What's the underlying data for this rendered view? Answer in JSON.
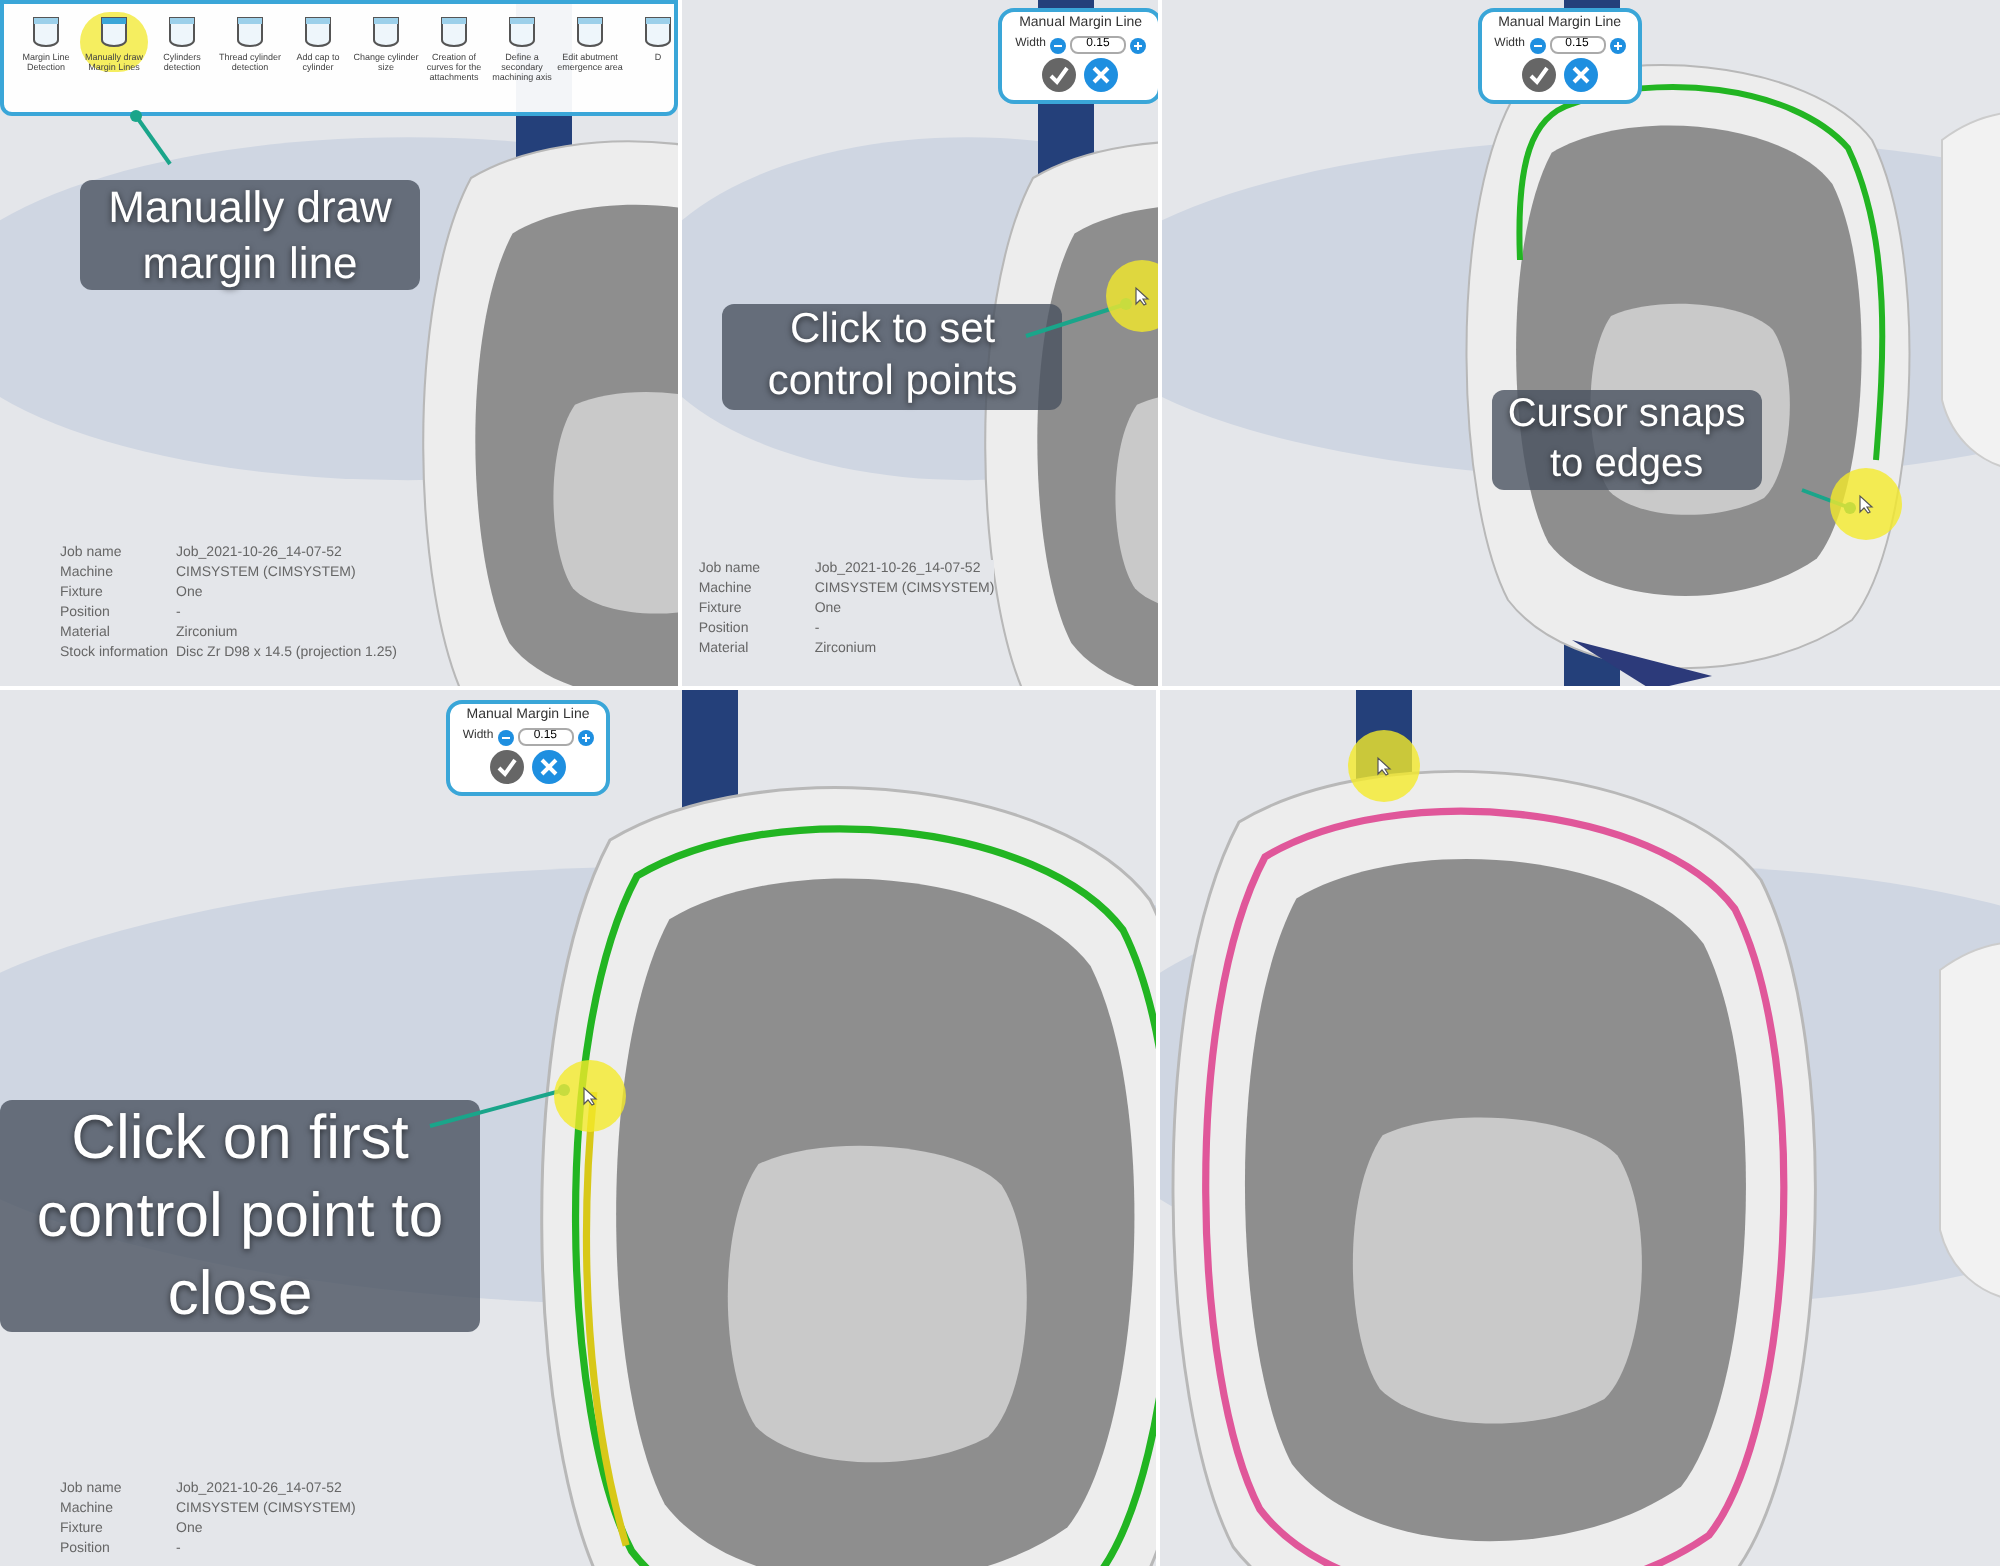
{
  "panels": [
    {
      "toolbar": [
        {
          "label": "Margin Line Detection",
          "selected": false
        },
        {
          "label": "Manually draw Margin Lines",
          "selected": true
        },
        {
          "label": "Cylinders detection",
          "selected": false
        },
        {
          "label": "Thread cylinder detection",
          "selected": false
        },
        {
          "label": "Add cap to cylinder",
          "selected": false
        },
        {
          "label": "Change cylinder size",
          "selected": false
        },
        {
          "label": "Creation of curves for the attachments",
          "selected": false
        },
        {
          "label": "Define a secondary machining axis",
          "selected": false
        },
        {
          "label": "Edit abutment emergence area",
          "selected": false
        },
        {
          "label": "D",
          "selected": false
        }
      ],
      "caption": "Manually draw margin line",
      "info": [
        {
          "label": "Job name",
          "value": "Job_2021-10-26_14-07-52"
        },
        {
          "label": "Machine",
          "value": "CIMSYSTEM (CIMSYSTEM)"
        },
        {
          "label": "Fixture",
          "value": "One"
        },
        {
          "label": "Position",
          "value": "-"
        },
        {
          "label": "Material",
          "value": "Zirconium"
        },
        {
          "label": "Stock information",
          "value": "Disc Zr D98 x 14.5 (projection 1.25)"
        }
      ],
      "margin_line": {
        "kind": "none"
      }
    },
    {
      "dialog": {
        "title": "Manual Margin Line",
        "label": "Width",
        "value": "0.15"
      },
      "caption": "Click to set control points",
      "cursor": true,
      "info": [
        {
          "label": "Job name",
          "value": "Job_2021-10-26_14-07-52"
        },
        {
          "label": "Machine",
          "value": "CIMSYSTEM (CIMSYSTEM)"
        },
        {
          "label": "Fixture",
          "value": "One"
        },
        {
          "label": "Position",
          "value": "-"
        },
        {
          "label": "Material",
          "value": "Zirconium"
        }
      ],
      "margin_line": {
        "kind": "none"
      }
    },
    {
      "dialog": {
        "title": "Manual Margin Line",
        "label": "Width",
        "value": "0.15"
      },
      "caption": "Cursor snaps to edges",
      "cursor": true,
      "margin_line": {
        "kind": "partial",
        "color": "#22b522"
      }
    },
    {
      "dialog": {
        "title": "Manual Margin Line",
        "label": "Width",
        "value": "0.15"
      },
      "caption": "Click on first control point to close",
      "cursor": true,
      "info": [
        {
          "label": "Job name",
          "value": "Job_2021-10-26_14-07-52"
        },
        {
          "label": "Machine",
          "value": "CIMSYSTEM (CIMSYSTEM)"
        },
        {
          "label": "Fixture",
          "value": "One"
        },
        {
          "label": "Position",
          "value": "-"
        }
      ],
      "margin_line": {
        "kind": "closed",
        "segments": [
          {
            "color": "#22b522"
          },
          {
            "color": "#d8c818"
          }
        ]
      }
    },
    {
      "cursor": true,
      "margin_line": {
        "kind": "closed",
        "color": "#e0579a"
      }
    }
  ]
}
